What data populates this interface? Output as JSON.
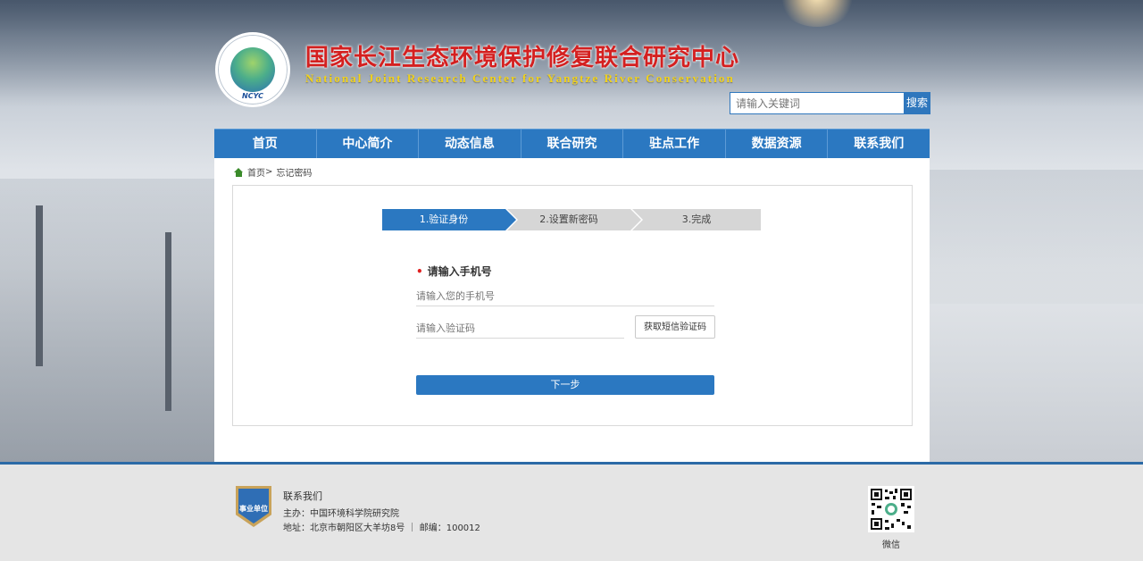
{
  "header": {
    "title": "国家长江生态环境保护修复联合研究中心",
    "subtitle": "National Joint Research Center for Yangtze River Conservation",
    "logo_text": "NCYC"
  },
  "search": {
    "placeholder": "请输入关键词",
    "button_label": "搜索"
  },
  "nav": {
    "items": [
      "首页",
      "中心简介",
      "动态信息",
      "联合研究",
      "驻点工作",
      "数据资源",
      "联系我们"
    ]
  },
  "breadcrumb": {
    "home": "首页",
    "separator": ">",
    "current": "忘记密码"
  },
  "steps": [
    "1.验证身份",
    "2.设置新密码",
    "3.完成"
  ],
  "form": {
    "required_mark": "•",
    "label": "请输入手机号",
    "phone_placeholder": "请输入您的手机号",
    "code_placeholder": "请输入验证码",
    "code_button": "获取短信验证码",
    "next_button": "下一步"
  },
  "footer": {
    "badge_text": "事业单位",
    "contact_title": "联系我们",
    "host": "主办：中国环境科学院研究院",
    "address": "地址：北京市朝阳区大羊坊8号 ｜ 邮编：100012",
    "qr_caption": "微信"
  },
  "colors": {
    "primary": "#2b78c1",
    "title_red": "#d42020",
    "subtitle_yellow": "#f2d21a",
    "step_inactive": "#d6d6d6"
  }
}
